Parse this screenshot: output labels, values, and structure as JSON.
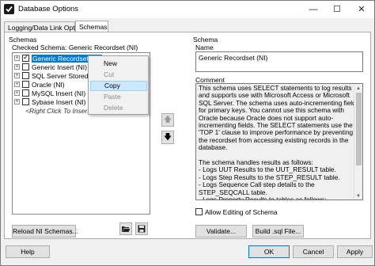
{
  "window": {
    "title": "Database Options"
  },
  "tabs": [
    {
      "label": "Logging/Data Link Options"
    },
    {
      "label": "Schemas"
    }
  ],
  "schemas_group": {
    "label": "Schemas",
    "current_schema_label": "Checked Schema: Generic Recordset (NI)",
    "items": [
      {
        "label": "Generic Recordset (NI)",
        "checked": true,
        "selected": true
      },
      {
        "label": "Generic Insert (NI)",
        "checked": false
      },
      {
        "label": "SQL Server Stored Pro",
        "checked": false
      },
      {
        "label": "Oracle (NI)",
        "checked": false
      },
      {
        "label": "MySQL Insert (NI)",
        "checked": false
      },
      {
        "label": "Sybase Insert (NI)",
        "checked": false
      }
    ],
    "hint": "<Right Click To Insert Sc",
    "reload_button": "Reload NI Schemas...",
    "open_icon": "folder-open-icon",
    "save_icon": "floppy-disk-icon"
  },
  "context_menu": {
    "items": [
      {
        "label": "New",
        "enabled": true
      },
      {
        "label": "Cut",
        "enabled": false
      },
      {
        "label": "Copy",
        "enabled": true,
        "highlighted": true
      },
      {
        "label": "Paste",
        "enabled": false
      },
      {
        "label": "Delete",
        "enabled": false
      }
    ]
  },
  "schema_group": {
    "label": "Schema",
    "name_label": "Name",
    "name_value": "Generic Recordset (NI)",
    "comment_label": "Comment",
    "comment_text": "This schema uses SELECT statements to log results and supports use with Microsoft Access or Microsoft SQL Server. The schema uses auto-incrementing fields for primary keys. You cannot use this schema with Oracle because Oracle does not support auto-incrementing fields. The SELECT statements use the 'TOP 1' clause to improve performance by preventing the recordset from accessing existing records in the database.\n\nThe schema handles results as follows:\n- Logs UUT Results to the UUT_RESULT table.\n- Logs Step Results to the STEP_RESULT table.\n- Logs Sequence Call step details to the STEP_SEQCALL table.\n- Logs Property Results to tables as follows:\n  - Logs general property information to PROP_RESULT.\n  - Logs string, number, and Boolean values to PROP_RESULT",
    "allow_editing_label": "Allow Editing of Schema",
    "allow_editing_checked": false,
    "validate_button": "Validate...",
    "build_button": "Build .sql File..."
  },
  "footer": {
    "help_button": "Help",
    "ok_button": "OK",
    "cancel_button": "Cancel",
    "apply_button": "Apply"
  },
  "colors": {
    "selection": "#0078d7",
    "menu_highlight": "#cce8ff"
  }
}
